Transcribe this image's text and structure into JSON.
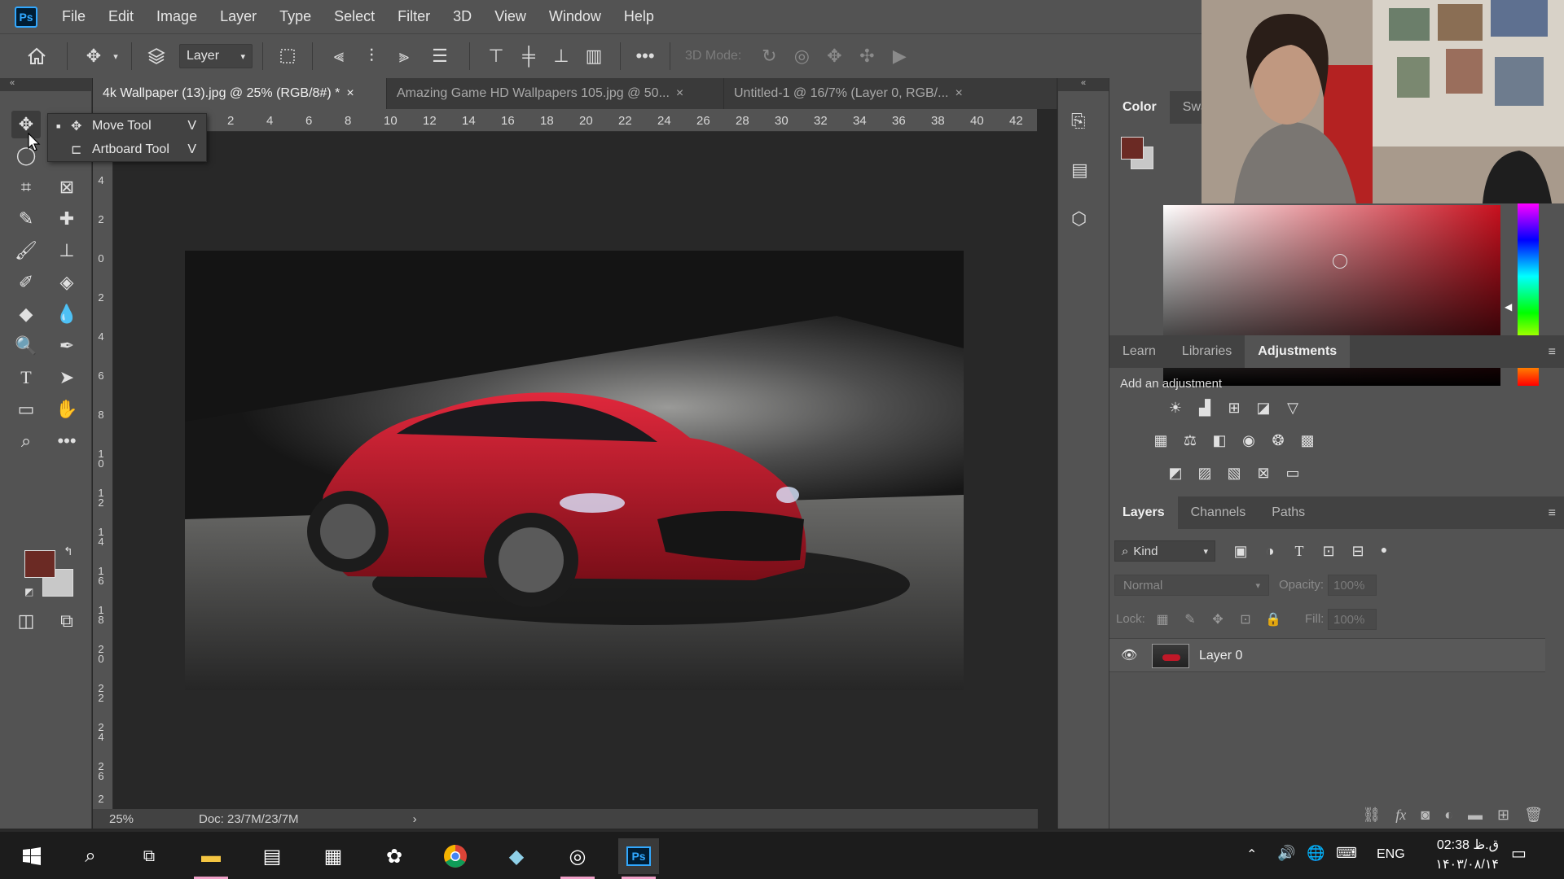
{
  "app": {
    "logo": "Ps"
  },
  "menu": [
    "File",
    "Edit",
    "Image",
    "Layer",
    "Type",
    "Select",
    "Filter",
    "3D",
    "View",
    "Window",
    "Help"
  ],
  "options": {
    "layer_select": "Layer",
    "mode3d_label": "3D Mode:"
  },
  "flyout": {
    "items": [
      {
        "label": "Move Tool",
        "key": "V"
      },
      {
        "label": "Artboard Tool",
        "key": "V"
      }
    ]
  },
  "tabs": [
    {
      "label": "4k Wallpaper (13).jpg @ 25% (RGB/8#) *",
      "active": true
    },
    {
      "label": "Amazing Game HD Wallpapers 105.jpg @ 50...",
      "active": false
    },
    {
      "label": "Untitled-1 @ 16/7% (Layer 0, RGB/...",
      "active": false
    }
  ],
  "ruler_h": [
    "2",
    "4",
    "6",
    "8",
    "10",
    "12",
    "14",
    "16",
    "18",
    "20",
    "22",
    "24",
    "26",
    "28",
    "30",
    "32",
    "34",
    "36",
    "38",
    "40",
    "42"
  ],
  "ruler_v": [
    "4",
    "2",
    "0",
    "2",
    "4",
    "6",
    "8",
    "10",
    "12",
    "14",
    "16",
    "18",
    "20",
    "22",
    "24",
    "26",
    "2"
  ],
  "status": {
    "zoom": "25%",
    "doc": "Doc: 23/7M/23/7M"
  },
  "color_panel": {
    "tabs": [
      "Color",
      "Swat"
    ],
    "fg": "#6b2a24",
    "bg": "#c8c8c8"
  },
  "adjustments_panel": {
    "tabs": [
      "Learn",
      "Libraries",
      "Adjustments"
    ],
    "active_tab": "Adjustments",
    "heading": "Add an adjustment"
  },
  "layers_panel": {
    "tabs": [
      "Layers",
      "Channels",
      "Paths"
    ],
    "filter_label": "Kind",
    "blend_mode": "Normal",
    "opacity_label": "Opacity:",
    "opacity": "100%",
    "lock_label": "Lock:",
    "fill_label": "Fill:",
    "fill": "100%",
    "layers": [
      {
        "name": "Layer 0",
        "visible": true
      }
    ]
  },
  "taskbar": {
    "lang": "ENG",
    "time": "02:38 ق.ظ",
    "date": "۱۴۰۳/۰۸/۱۴"
  }
}
